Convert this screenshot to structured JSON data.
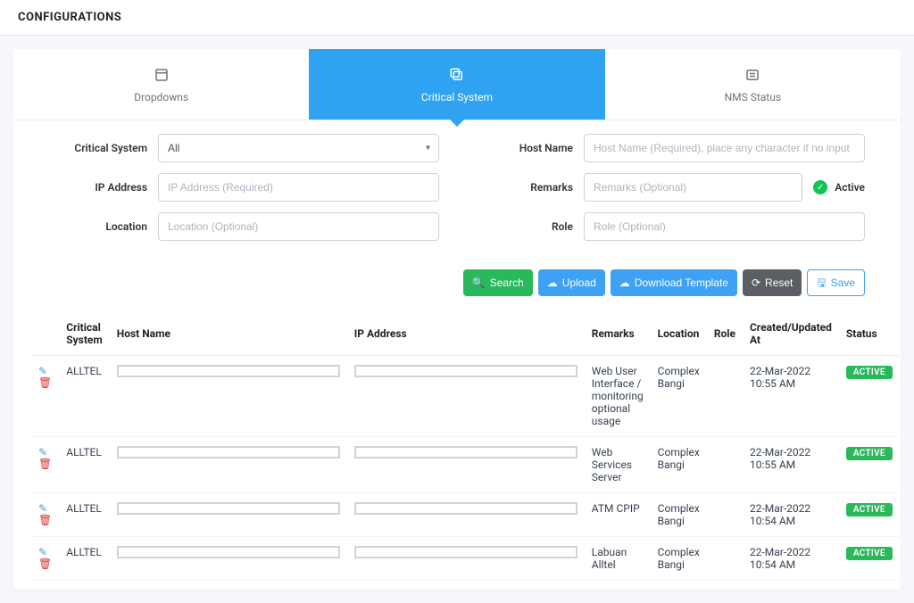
{
  "header": {
    "title": "CONFIGURATIONS"
  },
  "tabs": {
    "dropdowns": {
      "label": "Dropdowns"
    },
    "critical": {
      "label": "Critical System"
    },
    "nms": {
      "label": "NMS Status"
    }
  },
  "form": {
    "labels": {
      "critical_system": "Critical System",
      "ip_address": "IP Address",
      "location": "Location",
      "host_name": "Host Name",
      "remarks": "Remarks",
      "role": "Role",
      "active": "Active"
    },
    "values": {
      "critical_system": "All"
    },
    "placeholders": {
      "ip_address": "IP Address (Required)",
      "location": "Location (Optional)",
      "host_name": "Host Name (Required), place any character if no input",
      "remarks": "Remarks (Optional)",
      "role": "Role (Optional)"
    }
  },
  "buttons": {
    "search": "Search",
    "upload": "Upload",
    "download_template": "Download Template",
    "reset": "Reset",
    "save": "Save"
  },
  "table": {
    "headers": {
      "critical_system": "Critical System",
      "host_name": "Host Name",
      "ip_address": "IP Address",
      "remarks": "Remarks",
      "location": "Location",
      "role": "Role",
      "created_updated": "Created/Updated At",
      "status": "Status"
    },
    "rows": [
      {
        "critical_system": "ALLTEL",
        "remarks": "Web User Interface / monitoring optional usage",
        "location": "Complex Bangi",
        "role": "",
        "created_updated": "22-Mar-2022 10:55 AM",
        "status": "ACTIVE"
      },
      {
        "critical_system": "ALLTEL",
        "remarks": "Web Services Server",
        "location": "Complex Bangi",
        "role": "",
        "created_updated": "22-Mar-2022 10:55 AM",
        "status": "ACTIVE"
      },
      {
        "critical_system": "ALLTEL",
        "remarks": "ATM CPIP",
        "location": "Complex Bangi",
        "role": "",
        "created_updated": "22-Mar-2022 10:54 AM",
        "status": "ACTIVE"
      },
      {
        "critical_system": "ALLTEL",
        "remarks": "Labuan Alltel",
        "location": "Complex Bangi",
        "role": "",
        "created_updated": "22-Mar-2022 10:54 AM",
        "status": "ACTIVE"
      }
    ]
  }
}
